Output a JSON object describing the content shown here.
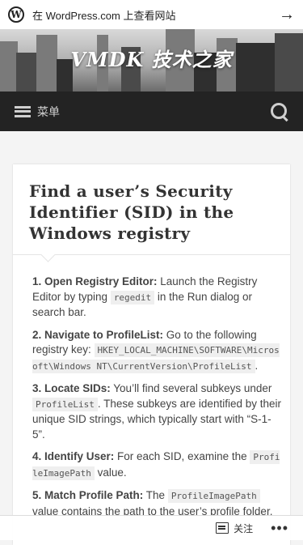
{
  "wpbar": {
    "logo_glyph": "W",
    "text": "在 WordPress.com 上查看网站",
    "arrow": "→"
  },
  "header": {
    "site_title": "VMDK 技术之家"
  },
  "nav": {
    "menu_label": "菜单"
  },
  "article": {
    "title": "Find a user’s Security Identifier (SID) in the Windows registry",
    "steps": [
      {
        "lead": "1. Open Registry Editor:",
        "pre": " Launch the Registry Editor by typing ",
        "code": "regedit",
        "post": " in the Run dialog or search bar."
      },
      {
        "lead": "2. Navigate to ProfileList:",
        "pre": " Go to the following registry key: ",
        "code": "HKEY_LOCAL_MACHINE\\SOFTWARE\\Microsoft\\Windows NT\\CurrentVersion\\ProfileList",
        "post": "."
      },
      {
        "lead": "3. Locate SIDs:",
        "pre": " You’ll find several subkeys under ",
        "code": "ProfileList",
        "post": ". These subkeys are identified by their unique SID strings, which typically start with “S-1-5”."
      },
      {
        "lead": "4. Identify User:",
        "pre": " For each SID, examine the ",
        "code": "ProfileImagePath",
        "post": " value."
      },
      {
        "lead": "5. Match Profile Path:",
        "pre": " The ",
        "code": "ProfileImagePath",
        "post": " value contains the path to the user’s profile folder."
      }
    ]
  },
  "actionbar": {
    "follow_label": "关注",
    "more": "•••"
  },
  "colors": {
    "nav_bg": "#232323",
    "page_bg": "#f4f4f4"
  }
}
